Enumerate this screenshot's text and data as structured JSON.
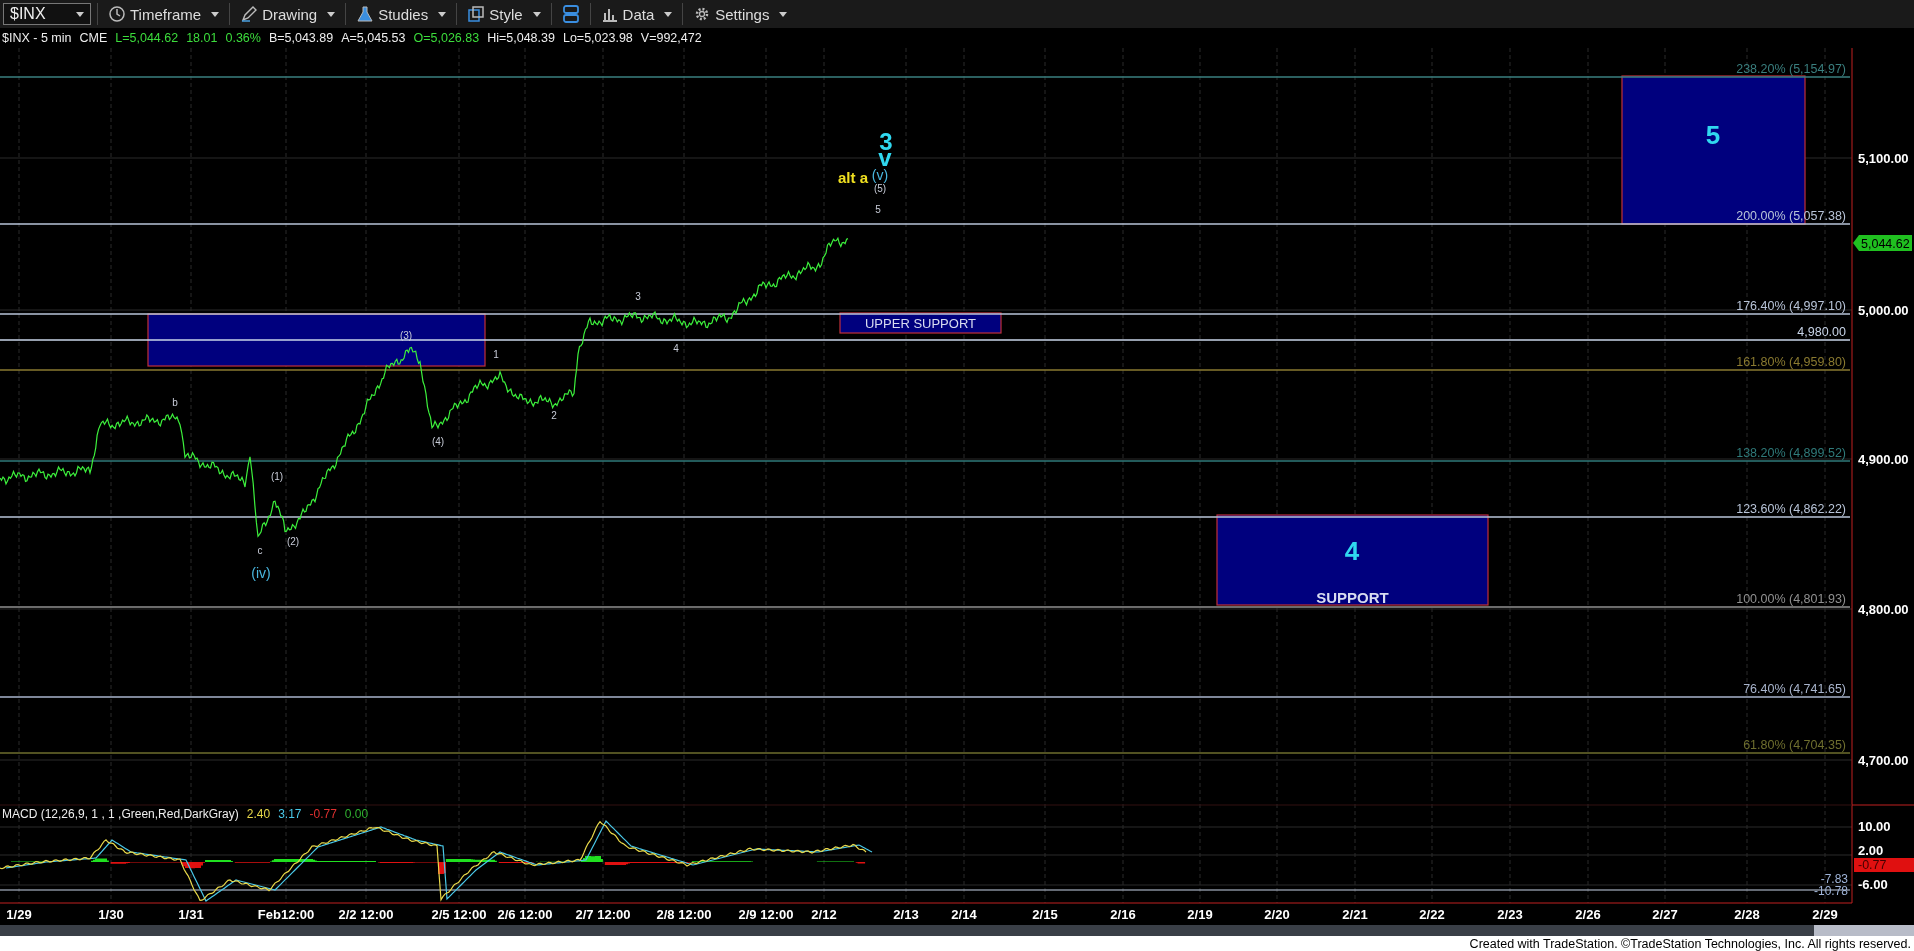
{
  "toolbar": {
    "symbol": "$INX",
    "buttons": [
      {
        "label": "Timeframe",
        "kind": "clock"
      },
      {
        "label": "Drawing",
        "kind": "pen"
      },
      {
        "label": "Studies",
        "kind": "flask"
      },
      {
        "label": "Style",
        "kind": "squares"
      },
      {
        "kind": "layout"
      },
      {
        "label": "Data",
        "kind": "bars"
      },
      {
        "label": "Settings",
        "kind": "gear"
      }
    ]
  },
  "quote": [
    {
      "text": "$INX - 5 min",
      "kind": "plain"
    },
    {
      "text": "CME",
      "kind": "plain"
    },
    {
      "text": "L=5,044.62",
      "kind": "up"
    },
    {
      "text": "18.01",
      "kind": "up"
    },
    {
      "text": "0.36%",
      "kind": "up"
    },
    {
      "text": "B=5,043.89",
      "kind": "plain"
    },
    {
      "text": "A=5,045.53",
      "kind": "plain"
    },
    {
      "text": "O=5,026.83",
      "kind": "up"
    },
    {
      "text": "Hi=5,048.39",
      "kind": "plain"
    },
    {
      "text": "Lo=5,023.98",
      "kind": "plain"
    },
    {
      "text": "V=992,472",
      "kind": "plain"
    }
  ],
  "chart": {
    "fib_levels": [
      {
        "label": "238.20% (5,154.97)",
        "color": "#3a7f7f"
      },
      {
        "label": "200.00% (5,057.38)",
        "color": "#b8c4d8"
      },
      {
        "label": "176.40% (4,997.10)",
        "color": "#b8c4d8"
      },
      {
        "label": "4,980.00",
        "color": "#c8d4e8"
      },
      {
        "label": "161.80% (4,959.80)",
        "color": "#8a7a30"
      },
      {
        "label": "138.20% (4,899.52)",
        "color": "#2f7a7a"
      },
      {
        "label": "123.60% (4,862.22)",
        "color": "#b8c4d8"
      },
      {
        "label": "100.00% (4,801.93)",
        "color": "#909090"
      },
      {
        "label": "76.40% (4,741.65)",
        "color": "#a8b4cc"
      },
      {
        "label": "61.80% (4,704.35)",
        "color": "#6e6e2e"
      }
    ],
    "price_axis": [
      "5,100.00",
      "5,000.00",
      "4,900.00",
      "4,800.00",
      "4,700.00"
    ],
    "last_price": "5,044.62",
    "zones": [
      {
        "kind": "target",
        "label": "5"
      },
      {
        "kind": "plain"
      },
      {
        "kind": "support",
        "label": "4",
        "caption": "SUPPORT"
      },
      {
        "kind": "caption",
        "caption": "UPPER SUPPORT"
      }
    ],
    "wave_labels": [
      {
        "text": "3",
        "kind": "major"
      },
      {
        "text": "v",
        "kind": "major"
      },
      {
        "text": "alt a",
        "kind": "alt"
      },
      {
        "text": "(v)",
        "kind": "minor"
      },
      {
        "text": "(5)",
        "kind": "small"
      },
      {
        "text": "5",
        "kind": "small"
      },
      {
        "text": "3",
        "kind": "small"
      },
      {
        "text": "4",
        "kind": "small"
      },
      {
        "text": "1",
        "kind": "small"
      },
      {
        "text": "2",
        "kind": "small"
      },
      {
        "text": "(3)",
        "kind": "small"
      },
      {
        "text": "(4)",
        "kind": "small"
      },
      {
        "text": "b",
        "kind": "small"
      },
      {
        "text": "(1)",
        "kind": "small"
      },
      {
        "text": "(2)",
        "kind": "small"
      },
      {
        "text": "c",
        "kind": "small"
      },
      {
        "text": "(iv)",
        "kind": "minor"
      }
    ],
    "dates": [
      "1/29",
      "1/30",
      "1/31",
      "Feb12:00",
      "2/2 12:00",
      "2/5 12:00",
      "2/6 12:00",
      "2/7 12:00",
      "2/8 12:00",
      "2/9 12:00",
      "2/12",
      "2/13",
      "2/14",
      "2/15",
      "2/16",
      "2/19",
      "2/20",
      "2/21",
      "2/22",
      "2/23",
      "2/26",
      "2/27",
      "2/28",
      "2/29"
    ]
  },
  "macd": {
    "title": "MACD (12,26,9, 1 , 1 ,Green,Red,DarkGray)",
    "values": [
      {
        "text": "2.40",
        "color": "#e8d84a"
      },
      {
        "text": "3.17",
        "color": "#4ac8e8"
      },
      {
        "text": "-0.77",
        "color": "#e03030"
      },
      {
        "text": "0.00",
        "color": "#30b030"
      }
    ],
    "axis": [
      "10.00",
      "2.00",
      "-6.00"
    ],
    "last_value": "-0.77",
    "extremes": [
      "-7.83",
      "-10.78"
    ]
  },
  "footer": "Created with TradeStation. ©TradeStation Technologies, Inc. All rights reserved."
}
